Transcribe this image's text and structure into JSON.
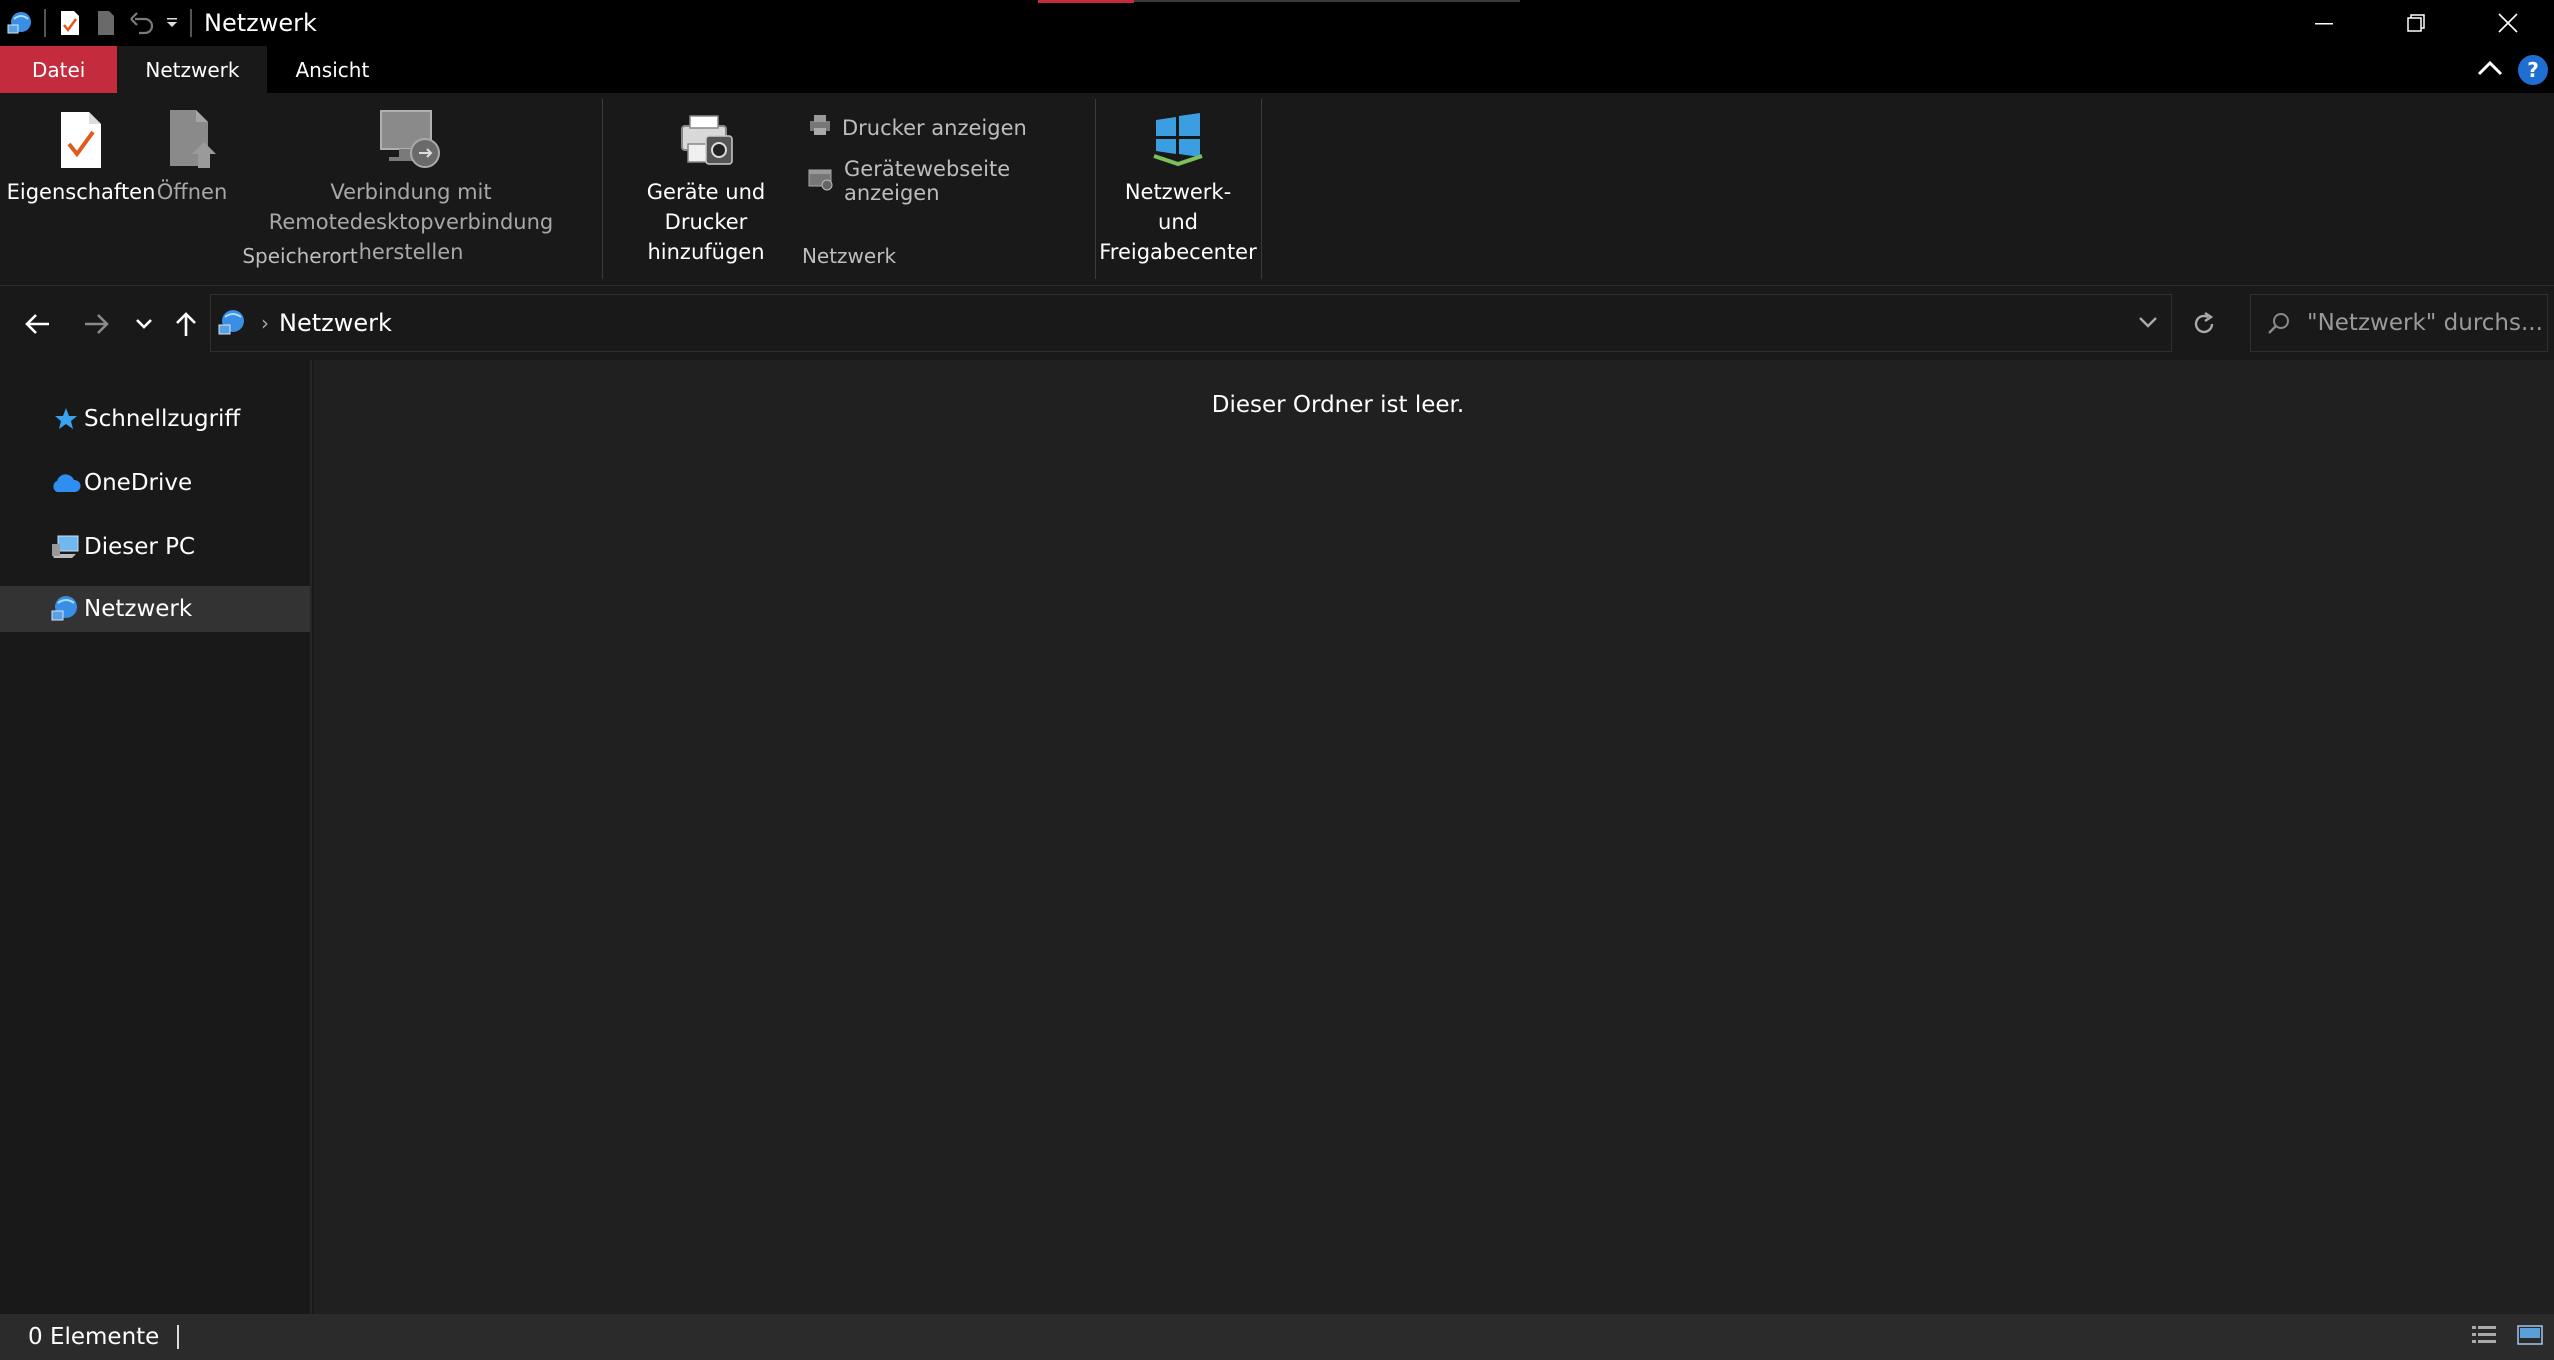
{
  "window": {
    "title": "Netzwerk"
  },
  "ribbon_tabs": [
    {
      "label": "Datei"
    },
    {
      "label": "Netzwerk"
    },
    {
      "label": "Ansicht"
    }
  ],
  "ribbon": {
    "speicherort": {
      "group_label": "Speicherort",
      "properties_label": "Eigenschaften",
      "open_label": "Öffnen",
      "remote_line1": "Verbindung mit",
      "remote_line2": "Remotedesktopverbindung herstellen"
    },
    "netzwerk": {
      "group_label": "Netzwerk",
      "add_devices_line1": "Geräte und Drucker",
      "add_devices_line2": "hinzufügen",
      "show_printers": "Drucker anzeigen",
      "show_device_webpage": "Gerätewebseite anzeigen"
    },
    "center": {
      "line1": "Netzwerk- und",
      "line2": "Freigabecenter"
    }
  },
  "address": {
    "crumb": "Netzwerk",
    "separator": "›"
  },
  "search": {
    "placeholder": "\"Netzwerk\" durchs..."
  },
  "nav_pane": {
    "items": [
      {
        "label": "Schnellzugriff",
        "icon": "star-icon"
      },
      {
        "label": "OneDrive",
        "icon": "cloud-icon"
      },
      {
        "label": "Dieser PC",
        "icon": "computer-icon"
      },
      {
        "label": "Netzwerk",
        "icon": "network-icon"
      }
    ]
  },
  "content": {
    "empty_message": "Dieser Ordner ist leer."
  },
  "status": {
    "item_count": "0 Elemente"
  },
  "colors": {
    "accent_file_tab": "#c42b3c",
    "background": "#191919",
    "content_background": "#202020",
    "help_blue": "#1e6fd1"
  }
}
